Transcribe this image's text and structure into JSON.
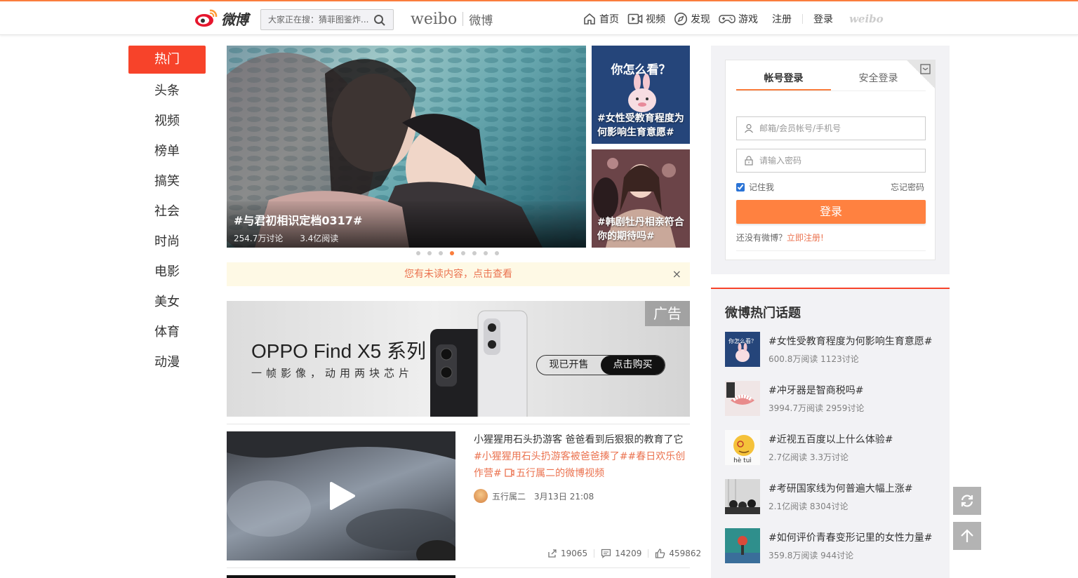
{
  "header": {
    "logo_text": "微博",
    "search_placeholder": "大家正在搜：猜菲图鉴炸...",
    "brand_en": "weibo",
    "brand_cn": "微博",
    "nav": [
      {
        "label": "首页",
        "icon": "home-icon"
      },
      {
        "label": "视频",
        "icon": "video-icon"
      },
      {
        "label": "发现",
        "icon": "compass-icon"
      },
      {
        "label": "游戏",
        "icon": "gamepad-icon"
      }
    ],
    "register": "注册",
    "login": "登录",
    "mini_logo": "weibo"
  },
  "leftnav": {
    "items": [
      "热门",
      "头条",
      "视频",
      "榜单",
      "搞笑",
      "社会",
      "时尚",
      "电影",
      "美女",
      "体育",
      "动漫"
    ],
    "active_index": 0
  },
  "carousel": {
    "main": {
      "title": "#与君初相识定档0317#",
      "discuss": "254.7万讨论",
      "reads": "3.4亿阅读"
    },
    "side": [
      {
        "label": "#女性受教育程度为何影响生育意愿#",
        "badge": "你怎么看？"
      },
      {
        "label": "#韩剧牡丹相亲符合你的期待吗#"
      }
    ],
    "dot_count": 8,
    "active_dot": 3
  },
  "tip": {
    "text": "您有未读内容，点击查看",
    "close": "×"
  },
  "ad": {
    "tag": "广告",
    "title": "OPPO Find X5 系列",
    "subtitle": "一帧影像，动用两块芯片",
    "btn_primary": "现已开售",
    "btn_secondary": "点击购买"
  },
  "feed": {
    "text": "小猩猩用石头扔游客 爸爸看到后狠狠的教育了它",
    "tags": "#小猩猩用石头扔游客被爸爸揍了##春日欢乐创作营# ",
    "video_link": "五行属二的微博视频",
    "author": "五行属二",
    "time": "3月13日 21:08",
    "reposts": "19065",
    "comments": "14209",
    "likes": "459862"
  },
  "login_box": {
    "tab_account": "帐号登录",
    "tab_secure": "安全登录",
    "user_placeholder": "邮箱/会员帐号/手机号",
    "pass_placeholder": "请输入密码",
    "remember": "记住我",
    "remember_checked": true,
    "forgot": "忘记密码",
    "submit": "登录",
    "no_account": "还没有微博？",
    "register_now": "立即注册!"
  },
  "hot_topics": {
    "title": "微博热门话题",
    "items": [
      {
        "title": "#女性受教育程度为何影响生育意愿#",
        "meta": "600.8万阅读 1123讨论"
      },
      {
        "title": "#冲牙器是智商税吗#",
        "meta": "3994.7万阅读 2959讨论"
      },
      {
        "title": "#近视五百度以上什么体验#",
        "meta": "2.7亿阅读 3.3万讨论"
      },
      {
        "title": "#考研国家线为何普遍大幅上涨#",
        "meta": "2.1亿阅读 8304讨论"
      },
      {
        "title": "#如何评价青春变形记里的女性力量#",
        "meta": "359.8万阅读 944讨论"
      }
    ]
  },
  "colors": {
    "accent": "#fa7d3c",
    "active_nav": "#f7432a",
    "link": "#eb7350",
    "tip_bg": "#fef9e5"
  }
}
